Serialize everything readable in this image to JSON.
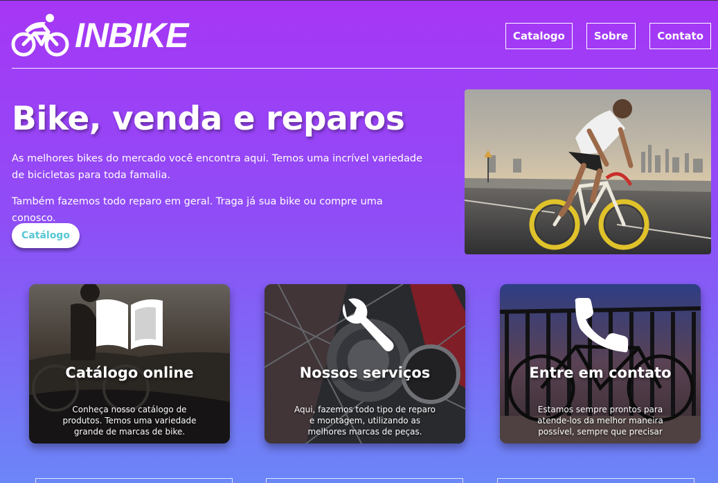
{
  "brand": {
    "name": "INBIKE"
  },
  "nav": {
    "items": [
      "Catalogo",
      "Sobre",
      "Contato"
    ]
  },
  "hero": {
    "title": "Bike, venda e reparos",
    "paragraph1": "As melhores bikes do mercado você encontra aqui. Temos uma incrível variedade de bicicletas para toda famalia.",
    "paragraph2": "Também fazemos todo reparo em geral. Traga já sua bike ou compre uma conosco.",
    "cta_label": "Catálogo"
  },
  "cards": [
    {
      "title": "Catálogo online",
      "description": "Conheça nosso catálogo de produtos. Temos uma variedade grande de marcas de bike.",
      "icon": "book-icon"
    },
    {
      "title": "Nossos serviços",
      "description": "Aqui, fazemos todo tipo de reparo e montagem, utilizando as melhores marcas de peças.",
      "icon": "wrench-icon"
    },
    {
      "title": "Entre em contato",
      "description": "Estamos sempre prontos para atende-los da melhor maneira possível, sempre que precisar",
      "icon": "phone-icon"
    }
  ],
  "colors": {
    "gradient_top": "#a636f5",
    "gradient_bottom": "#6b86f7",
    "cta_text": "#57c7d4"
  }
}
